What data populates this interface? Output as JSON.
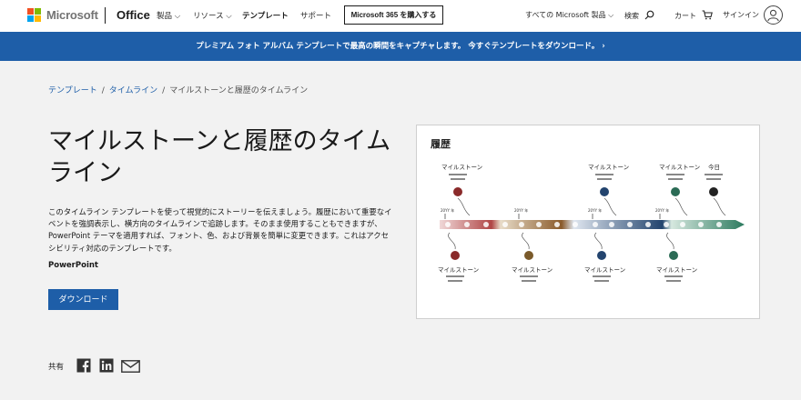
{
  "nav": {
    "brand": "Microsoft",
    "product": "Office",
    "items": [
      "製品 ⌵",
      "リソース ⌵",
      "テンプレート",
      "サポート"
    ],
    "buy_button": "Microsoft 365 を購入する",
    "all_products": "すべての Microsoft 製品 ⌵",
    "search": "検索",
    "cart": "カート",
    "signin": "サインイン"
  },
  "banner": {
    "text": "プレミアム フォト アルバム テンプレートで最高の瞬間をキャプチャします。 今すぐテンプレートをダウンロード。 ›"
  },
  "breadcrumb": {
    "items": [
      "テンプレート",
      "タイムライン",
      "マイルストーンと履歴のタイムライン"
    ]
  },
  "main": {
    "title": "マイルストーンと履歴のタイムライン",
    "description": "このタイムライン テンプレートを使って視覚的にストーリーを伝えましょう。履歴において重要なイベントを強調表示し、横方向のタイムラインで追跡します。そのまま使用することもできますが、PowerPoint テーマを適用すれば、フォント、色、および背景を簡単に変更できます。これはアクセシビリティ対応のテンプレートです。",
    "app": "PowerPoint",
    "download_button": "ダウンロード",
    "share_label": "共有"
  },
  "preview": {
    "title": "履歴",
    "top_labels": [
      "マイルストーン",
      "マイルストーン",
      "マイルストーン",
      "今日"
    ],
    "bottom_labels": [
      "マイルストーン",
      "マイルストーン",
      "マイルストーン",
      "マイルストーン"
    ],
    "year_label": "20YY 年",
    "colors": {
      "accent": "#1e5ea8",
      "banner": "#1e5ea8",
      "m_dark_red": "#8a2a2a",
      "m_brown": "#7a5a2a",
      "m_navy": "#23446e",
      "m_green": "#2b6b55",
      "m_black": "#222222"
    }
  }
}
